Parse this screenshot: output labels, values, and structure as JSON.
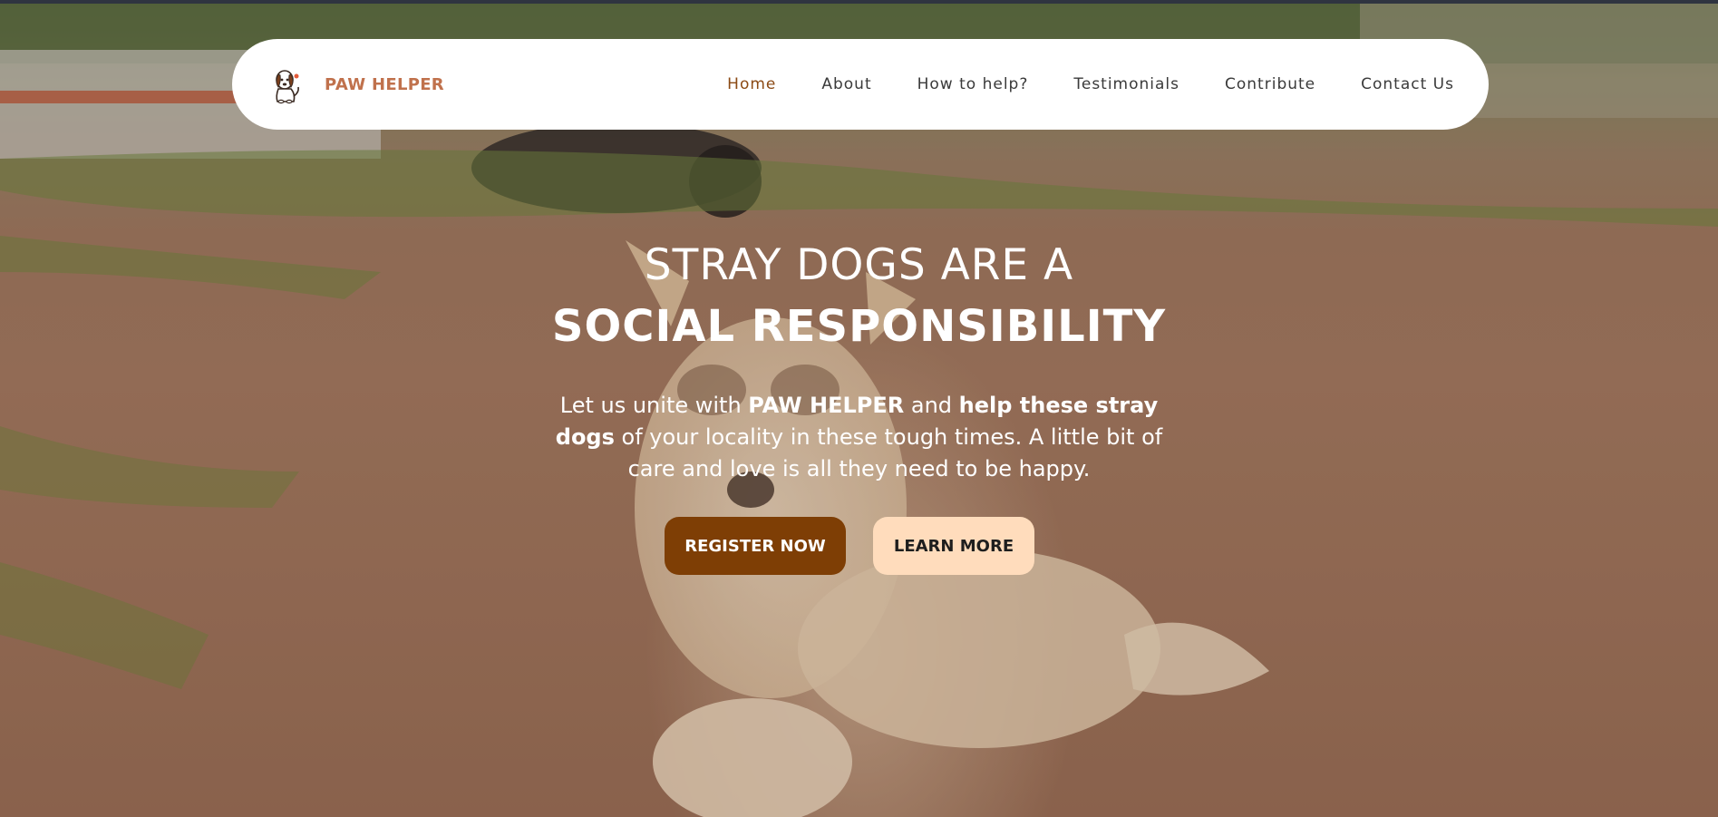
{
  "brand": {
    "name": "PAW HELPER",
    "logo_icon": "puppy-logo-icon",
    "color": "#c0714c"
  },
  "nav": {
    "items": [
      {
        "label": "Home",
        "active": true
      },
      {
        "label": "About",
        "active": false
      },
      {
        "label": "How to help?",
        "active": false
      },
      {
        "label": "Testimonials",
        "active": false
      },
      {
        "label": "Contribute",
        "active": false
      },
      {
        "label": "Contact Us",
        "active": false
      }
    ],
    "active_color": "#8b4a14"
  },
  "hero": {
    "headline_line1": "STRAY DOGS ARE A",
    "headline_line2": "SOCIAL RESPONSIBILITY",
    "description": {
      "t1": "Let us unite with ",
      "b1": "PAW HELPER",
      "t2": " and ",
      "b2": "help these stray dogs",
      "t3": " of your locality in these tough times. A little bit of care and love is all they need to be happy."
    },
    "buttons": {
      "register": "REGISTER NOW",
      "learn_more": "LEARN MORE"
    },
    "background_image": "stray dog lying on dirt ground",
    "colors": {
      "register_bg": "#7e3e05",
      "learn_more_bg": "#ffdcbc"
    }
  }
}
